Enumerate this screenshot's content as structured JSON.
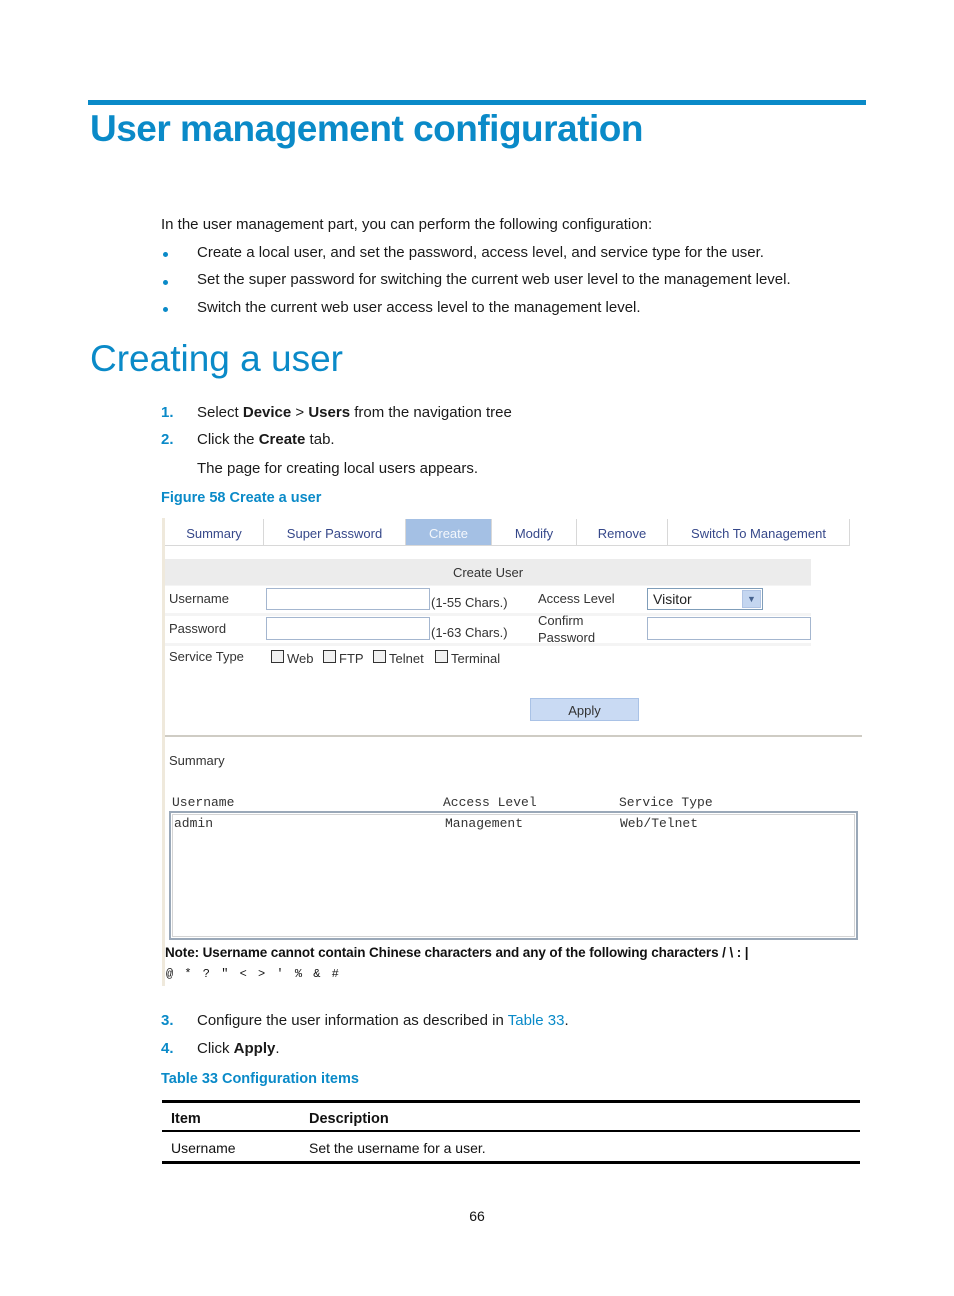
{
  "page": {
    "title": "User management configuration",
    "intro": "In the user management part, you can perform the following configuration:",
    "bullets": [
      "Create a local user, and set the password, access level, and service type for the user.",
      "Set the super password for switching the current web user level to the management level.",
      "Switch the current web user access level to the management level."
    ],
    "section_title": "Creating a user",
    "steps": [
      {
        "num": "1.",
        "pre": "Select ",
        "b1": "Device",
        "mid": " > ",
        "b2": "Users",
        "post": " from the navigation tree"
      },
      {
        "num": "2.",
        "pre": "Click the ",
        "b1": "Create",
        "post": " tab."
      },
      {
        "num": "",
        "text": "The page for creating local users appears."
      },
      {
        "num": "3.",
        "pre": "Configure the user information as described in ",
        "link": "Table 33",
        "post": "."
      },
      {
        "num": "4.",
        "pre": "Click ",
        "b1": "Apply",
        "post": "."
      }
    ],
    "figure_caption": "Figure 58 Create a user",
    "table_caption": "Table 33 Configuration items",
    "page_number": "66",
    "accent_color": "#0a8ac8"
  },
  "figure": {
    "tabs": [
      {
        "label": "Summary",
        "active": false
      },
      {
        "label": "Super Password",
        "active": false
      },
      {
        "label": "Create",
        "active": true
      },
      {
        "label": "Modify",
        "active": false
      },
      {
        "label": "Remove",
        "active": false
      },
      {
        "label": "Switch To Management",
        "active": false
      }
    ],
    "panel_title": "Create User",
    "form": {
      "username_label": "Username",
      "username_value": "",
      "username_hint": "(1-55 Chars.)",
      "password_label": "Password",
      "password_value": "",
      "password_hint": "(1-63 Chars.)",
      "access_level_label": "Access Level",
      "access_level_value": "Visitor",
      "confirm_label_1": "Confirm",
      "confirm_label_2": "Password",
      "confirm_value": "",
      "service_type_label": "Service Type",
      "service_types": [
        {
          "label": "Web",
          "checked": false
        },
        {
          "label": "FTP",
          "checked": false
        },
        {
          "label": "Telnet",
          "checked": false
        },
        {
          "label": "Terminal",
          "checked": false
        }
      ],
      "apply_label": "Apply"
    },
    "summary": {
      "title": "Summary",
      "columns": [
        "Username",
        "Access Level",
        "Service Type"
      ],
      "rows": [
        [
          "admin",
          "Management",
          "Web/Telnet"
        ]
      ]
    },
    "note_line1": "Note: Username cannot contain Chinese characters and any of the following characters  /  \\  :  |",
    "note_line2": "@ * ? \" < > ' % & #"
  },
  "config_table": {
    "columns": [
      "Item",
      "Description"
    ],
    "rows": [
      [
        "Username",
        "Set the username for a user."
      ]
    ]
  }
}
